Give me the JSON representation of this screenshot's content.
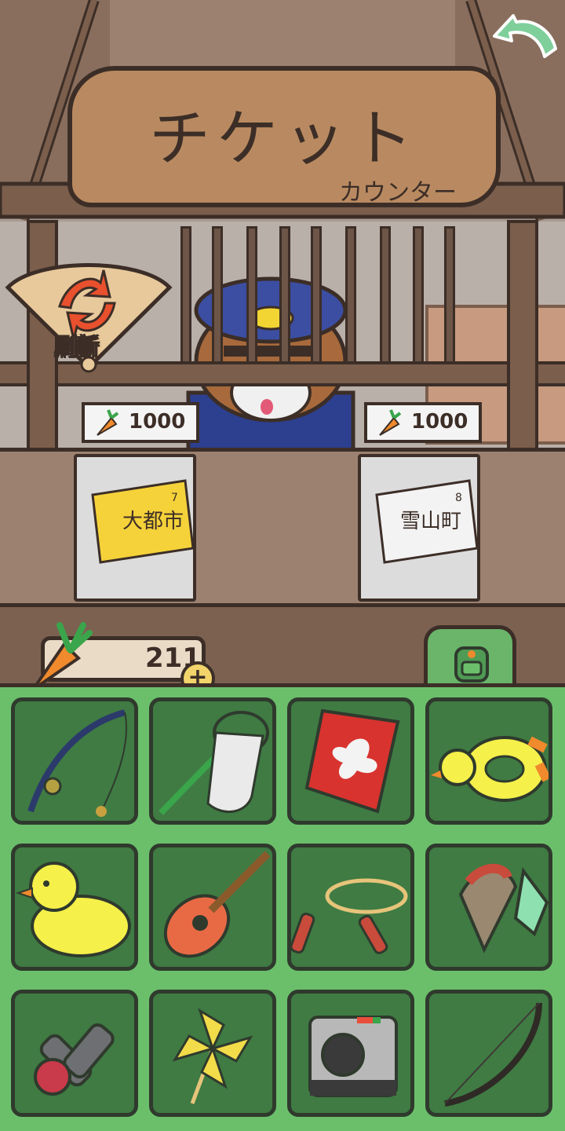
{
  "header": {
    "sign_title": "チケット",
    "sign_subtitle": "カウンター",
    "back_icon": "back-arrow-icon"
  },
  "refresh": {
    "label": "刷新",
    "icon": "refresh-arrows-icon"
  },
  "tickets": [
    {
      "price": "1000",
      "currency_icon": "carrot-icon",
      "ticket_text": "大都市",
      "ticket_number": "7"
    },
    {
      "price": "1000",
      "currency_icon": "carrot-icon",
      "ticket_text": "雪山町",
      "ticket_number": "8"
    }
  ],
  "wallet": {
    "carrots": "211",
    "add_label": "+",
    "icon": "carrot-icon"
  },
  "bag": {
    "icon": "backpack-icon"
  },
  "inventory": [
    {
      "name": "fishing-rod"
    },
    {
      "name": "bug-net"
    },
    {
      "name": "kite"
    },
    {
      "name": "duck-float-ring"
    },
    {
      "name": "rubber-duck"
    },
    {
      "name": "ukulele"
    },
    {
      "name": "jump-rope"
    },
    {
      "name": "spinning-top"
    },
    {
      "name": "kendama"
    },
    {
      "name": "pinwheel"
    },
    {
      "name": "instant-camera"
    },
    {
      "name": "bow"
    }
  ],
  "colors": {
    "panel_green": "#6bbf6b",
    "slot_green": "#3f7b43",
    "wood": "#9c8171",
    "outline": "#3c2e27"
  }
}
